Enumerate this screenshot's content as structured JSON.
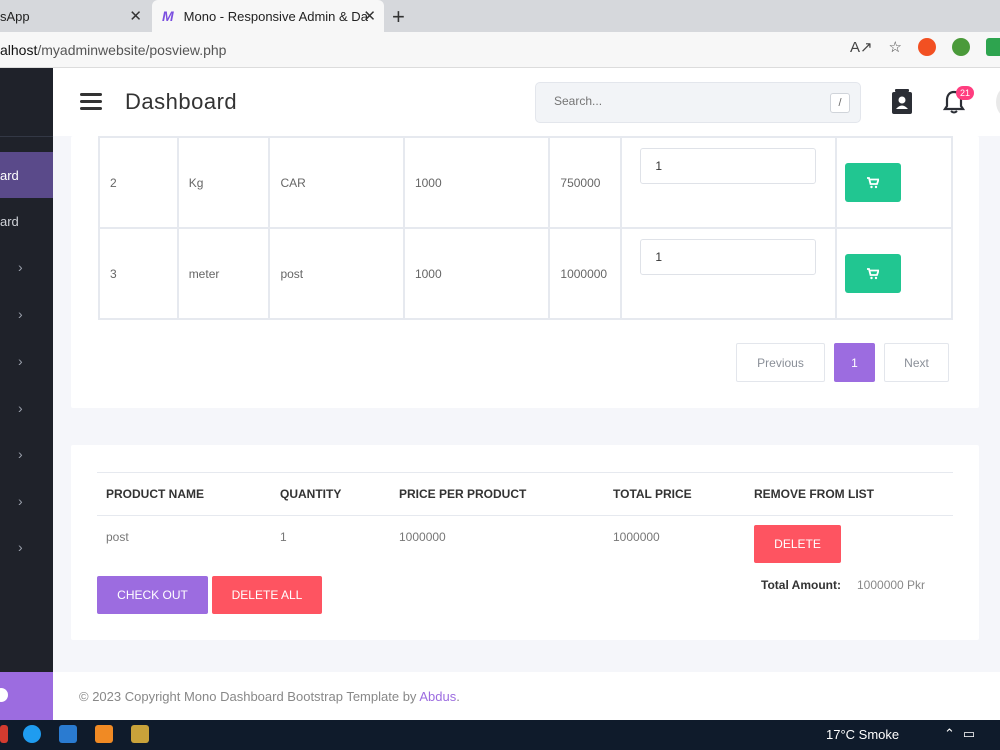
{
  "browser": {
    "tabs": [
      {
        "label": "sApp"
      },
      {
        "label": "Mono - Responsive Admin & Da"
      }
    ],
    "url_prefix": "alhost",
    "url_path": "/myadminwebsite/posview.php"
  },
  "sidebar": {
    "items": [
      {
        "label": "ard"
      },
      {
        "label": "ard"
      }
    ]
  },
  "header": {
    "title": "Dashboard",
    "search_placeholder": "Search...",
    "search_shortcut": "/",
    "notification_count": "21"
  },
  "products": {
    "rows": [
      {
        "id": "2",
        "unit": "Kg",
        "name": "CAR",
        "stock": "1000",
        "price": "750000",
        "qty": "1"
      },
      {
        "id": "3",
        "unit": "meter",
        "name": "post",
        "stock": "1000",
        "price": "1000000",
        "qty": "1"
      }
    ]
  },
  "pagination": {
    "previous": "Previous",
    "current": "1",
    "next": "Next"
  },
  "cart": {
    "headers": [
      "PRODUCT NAME",
      "QUANTITY",
      "PRICE PER PRODUCT",
      "TOTAL PRICE",
      "REMOVE FROM LIST"
    ],
    "rows": [
      {
        "name": "post",
        "quantity": "1",
        "price": "1000000",
        "total": "1000000",
        "action": "DELETE"
      }
    ],
    "checkout_label": "CHECK OUT",
    "delete_all_label": "DELETE ALL",
    "total_label": "Total Amount:",
    "total_value": "1000000 Pkr"
  },
  "footer": {
    "text": "© 2023 Copyright Mono Dashboard Bootstrap Template by ",
    "link": "Abdus",
    "suffix": "."
  },
  "taskbar": {
    "weather": "17°C  Smoke"
  },
  "colors": {
    "accent": "#9c6ce0",
    "success": "#21c691",
    "danger": "#fe5461",
    "sidebar": "#1f222a"
  }
}
